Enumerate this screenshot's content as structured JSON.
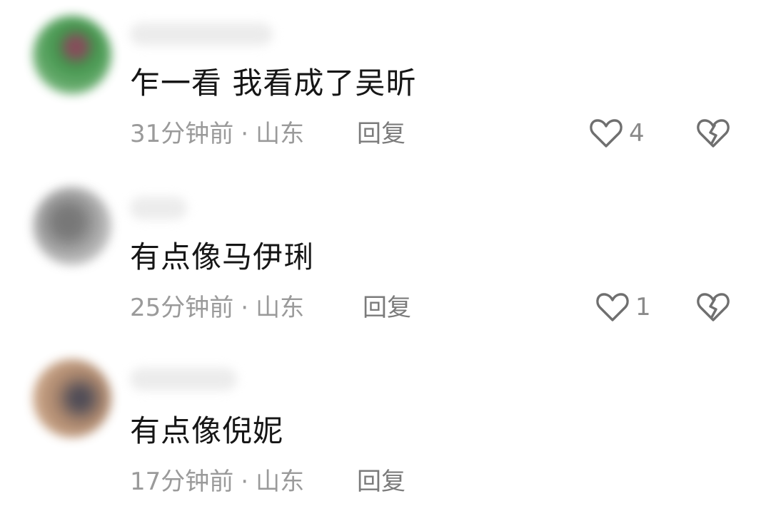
{
  "comments": [
    {
      "text": "乍一看 我看成了吴昕",
      "time": "31分钟前",
      "separator": "·",
      "location": "山东",
      "reply_label": "回复",
      "likes": "4",
      "avatar_color": "#3f8f45"
    },
    {
      "text": "有点像马伊琍",
      "time": "25分钟前",
      "separator": "·",
      "location": "山东",
      "reply_label": "回复",
      "likes": "1",
      "avatar_color": "#8a8a8a"
    },
    {
      "text": "有点像倪妮",
      "time": "17分钟前",
      "separator": "·",
      "location": "山东",
      "reply_label": "回复",
      "avatar_color": "#8b6a52"
    }
  ]
}
